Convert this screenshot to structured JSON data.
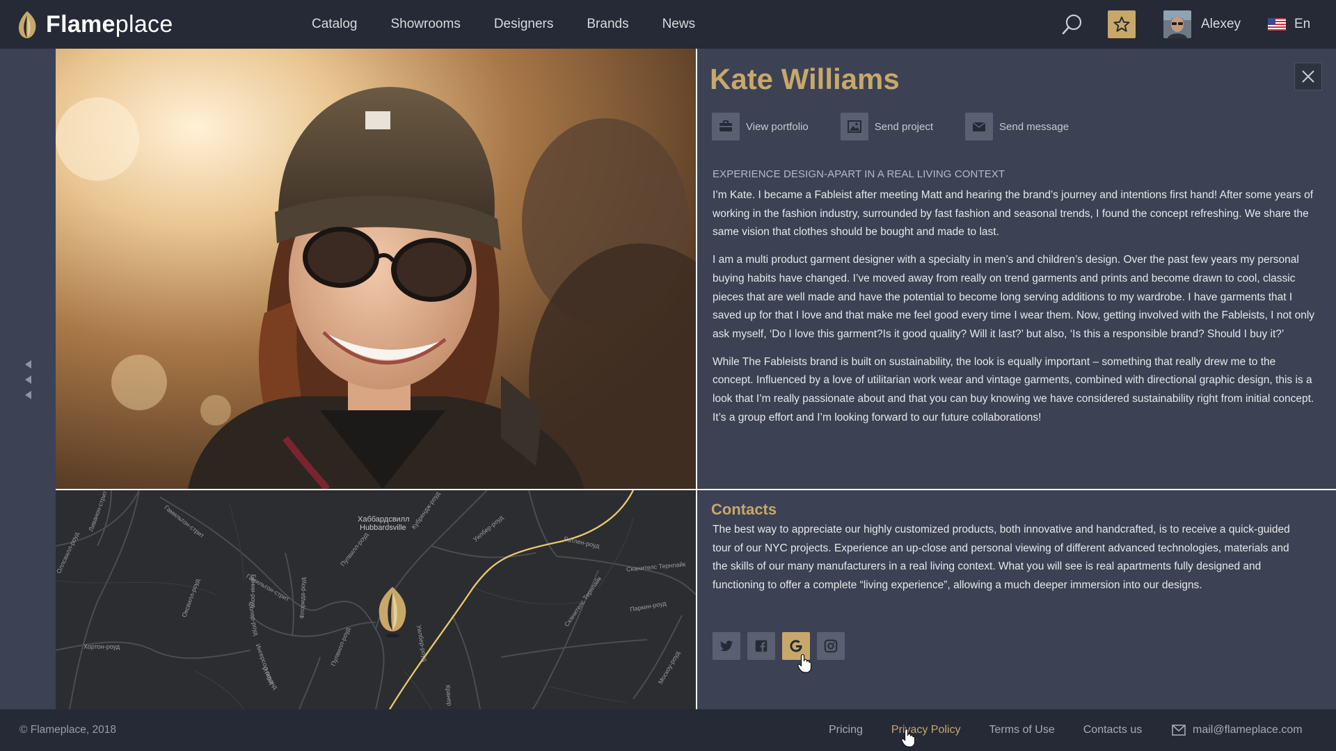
{
  "header": {
    "logo": {
      "bold": "Flame",
      "light": "place"
    },
    "nav": [
      "Catalog",
      "Showrooms",
      "Designers",
      "Brands",
      "News"
    ],
    "user": {
      "name": "Alexey"
    },
    "language": "En"
  },
  "designer": {
    "name": "Kate Williams",
    "actions": [
      "View portfolio",
      "Send project",
      "Send message"
    ],
    "heading": "EXPERIENCE DESIGN-APART IN A REAL LIVING CONTEXT",
    "paragraphs": [
      "I’m Kate. I became a Fableist after meeting Matt and hearing the brand’s journey and intentions first hand! After some years of working in the fashion industry, surrounded by fast fashion and seasonal trends, I found the concept refreshing. We share the same vision that clothes should be bought and made to last.",
      "I am a multi product garment designer with a specialty in men’s and children’s design. Over the past few years my personal buying habits have changed. I’ve moved away from really on trend garments and prints and become drawn to cool, classic pieces that are well made and have the potential to become long serving additions to my wardrobe. I have garments that I saved up for that I love and that make me feel good every time I wear them. Now, getting involved with the Fableists, I not only ask myself, ‘Do I love this garment?Is it good quality? Will it last?’ but also, ‘Is this a responsible brand? Should I buy it?’",
      "While The Fableists brand is built on sustainability, the look is equally important – something that really drew me to the concept. Influenced by a love of utilitarian work wear and vintage garments, combined with directional graphic design, this is a look that I’m really passionate about and that you can buy knowing we have considered sustainability right from initial concept. It’s a group effort and I’m looking forward to our future collaborations!"
    ]
  },
  "contacts": {
    "title": "Contacts",
    "text": "The best way to appreciate our highly customized products, both innovative and handcrafted, is to receive a quick-guided tour of our NYC projects. Experience an up-close and personal viewing of different advanced technologies, materials and the skills of our many manufacturers in a real living context. What you will see is real apartments fully designed and functioning to offer a complete “living experience”, allowing a much deeper immersion into our designs.",
    "socials": [
      "twitter",
      "facebook",
      "google",
      "instagram"
    ]
  },
  "map": {
    "labels": [
      "Хаббардсвилл",
      "Hubbardsville",
      "Гамильтон-стрит",
      "Гамильтон-стрит",
      "Пулвилл-роуд",
      "Пулвилл-роуд",
      "Кубрендж-роуд",
      "Ратлен-роуд",
      "Сканителс Тернпайк",
      "Сканителс Тернпайк",
      "Паркин-роуд",
      "Москоу-роуд",
      "Хортон-роуд",
      "Ливанон-стрит",
      "Оксвилл-роуд",
      "Уилбер-роуд",
      "Уилбер-роуд",
      "Ингерсол-роуд",
      "Флорида-роуд",
      "Бонни-роуд",
      "Сопер-роуд",
      "Итеронд",
      "Кранер",
      "Оллсвилл-роуд"
    ]
  },
  "footer": {
    "copyright": "© Flameplace, 2018",
    "links": [
      "Pricing",
      "Privacy Policy",
      "Terms of Use",
      "Contacts us"
    ],
    "email": "mail@flameplace.com"
  },
  "colors": {
    "accent": "#c8a86a",
    "header_bg": "#252a36",
    "panel_bg": "#3c4253",
    "icon_button_bg": "#5a6072",
    "map_bg": "#2b2d30",
    "route": "#e8c76a"
  },
  "icons": {
    "logo": "flame-icon",
    "search": "search-icon",
    "favorites": "star-icon",
    "language": "us-flag-icon",
    "close": "close-icon",
    "rail": "chevron-left-icon",
    "actions": [
      "briefcase-icon",
      "image-icon",
      "envelope-icon"
    ],
    "mail": "envelope-icon"
  }
}
